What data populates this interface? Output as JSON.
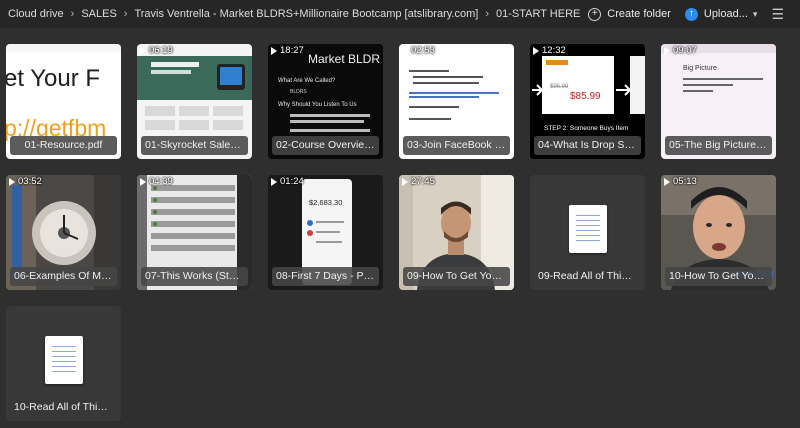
{
  "breadcrumb": [
    "Cloud drive",
    "SALES",
    "Travis Ventrella - Market BLDRS+Millionaire Bootcamp [atslibrary.com]",
    "01-START HERE"
  ],
  "actions": {
    "create_folder": "Create folder",
    "upload": "Upload..."
  },
  "files": [
    {
      "name": "01-Resource.pdf",
      "duration": "",
      "kind": "pdf"
    },
    {
      "name": "01-Skyrocket Sales an...",
      "duration": "06:19",
      "kind": "video"
    },
    {
      "name": "02-Course Overview....",
      "duration": "18:27",
      "kind": "video"
    },
    {
      "name": "03-Join FaceBook Gro...",
      "duration": "02:53",
      "kind": "video"
    },
    {
      "name": "04-What Is Drop Ship...",
      "duration": "12:32",
      "kind": "video"
    },
    {
      "name": "05-The Big Picture.mp4",
      "duration": "09:07",
      "kind": "video"
    },
    {
      "name": "06-Examples Of Mee...",
      "duration": "03:52",
      "kind": "video"
    },
    {
      "name": "07-This Works (Stude...",
      "duration": "04:39",
      "kind": "video"
    },
    {
      "name": "08-First 7 Days - PER...",
      "duration": "01:24",
      "kind": "video"
    },
    {
      "name": "09-How To Get Your ...",
      "duration": "27:45",
      "kind": "video"
    },
    {
      "name": "09-Read All of This.txt",
      "duration": "",
      "kind": "txt"
    },
    {
      "name": "10-How To Get Your ...",
      "duration": "05:13",
      "kind": "video"
    },
    {
      "name": "10-Read All of This.txt",
      "duration": "",
      "kind": "txt"
    }
  ],
  "thumb_text": {
    "resource": "et Your F",
    "resource_url": "p://getfbm",
    "market_bldr": "Market BLDR",
    "what_called": "What Are We Called?",
    "bldrs": "BLDRS",
    "why_listen": "Why Should You Listen To Us",
    "big_picture": "Big Picture",
    "step2": "STEP 2: Someone Buys Item",
    "price_old": "$96.99",
    "price_new": "$85.99",
    "amount": "$2,683.30"
  }
}
